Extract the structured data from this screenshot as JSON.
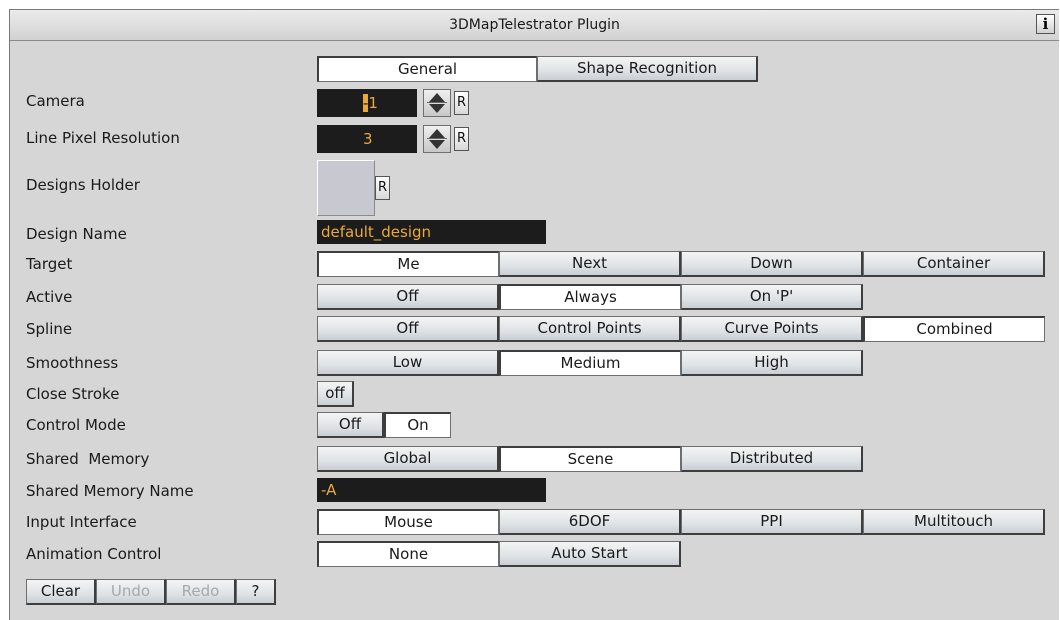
{
  "title": "3DMapTelestrator Plugin",
  "info_label": "i",
  "tabs": [
    "General",
    "Shape Recognition"
  ],
  "labels": {
    "camera": "Camera",
    "line_pixel_resolution": "Line Pixel Resolution",
    "designs_holder": "Designs Holder",
    "design_name": "Design Name",
    "target": "Target",
    "active": "Active",
    "spline": "Spline",
    "smoothness": "Smoothness",
    "close_stroke": "Close Stroke",
    "control_mode": "Control Mode",
    "shared_memory": "Shared  Memory",
    "shared_memory_name": "Shared Memory Name",
    "input_interface": "Input Interface",
    "animation_control": "Animation Control"
  },
  "camera": {
    "cursor_char": "-",
    "value_rest": "1"
  },
  "line_pixel_resolution": {
    "value": "3"
  },
  "reset_label": "R",
  "design_name_value": "default_design",
  "shared_memory_name_value": "-A",
  "target_options": [
    "Me",
    "Next",
    "Down",
    "Container"
  ],
  "active_options": [
    "Off",
    "Always",
    "On 'P'"
  ],
  "spline_options": [
    "Off",
    "Control Points",
    "Curve Points",
    "Combined"
  ],
  "smoothness_options": [
    "Low",
    "Medium",
    "High"
  ],
  "close_stroke_value": "off",
  "control_mode_options": [
    "Off",
    "On"
  ],
  "shared_memory_options": [
    "Global",
    "Scene",
    "Distributed"
  ],
  "input_interface_options": [
    "Mouse",
    "6DOF",
    "PPI",
    "Multitouch"
  ],
  "animation_control_options": [
    "None",
    "Auto Start"
  ],
  "bottom_buttons": [
    "Clear",
    "Undo",
    "Redo",
    "?"
  ],
  "colors": {
    "panel_bg": "#d6d6d6",
    "field_bg": "#1c1c1c",
    "field_text": "#e8a93a"
  }
}
